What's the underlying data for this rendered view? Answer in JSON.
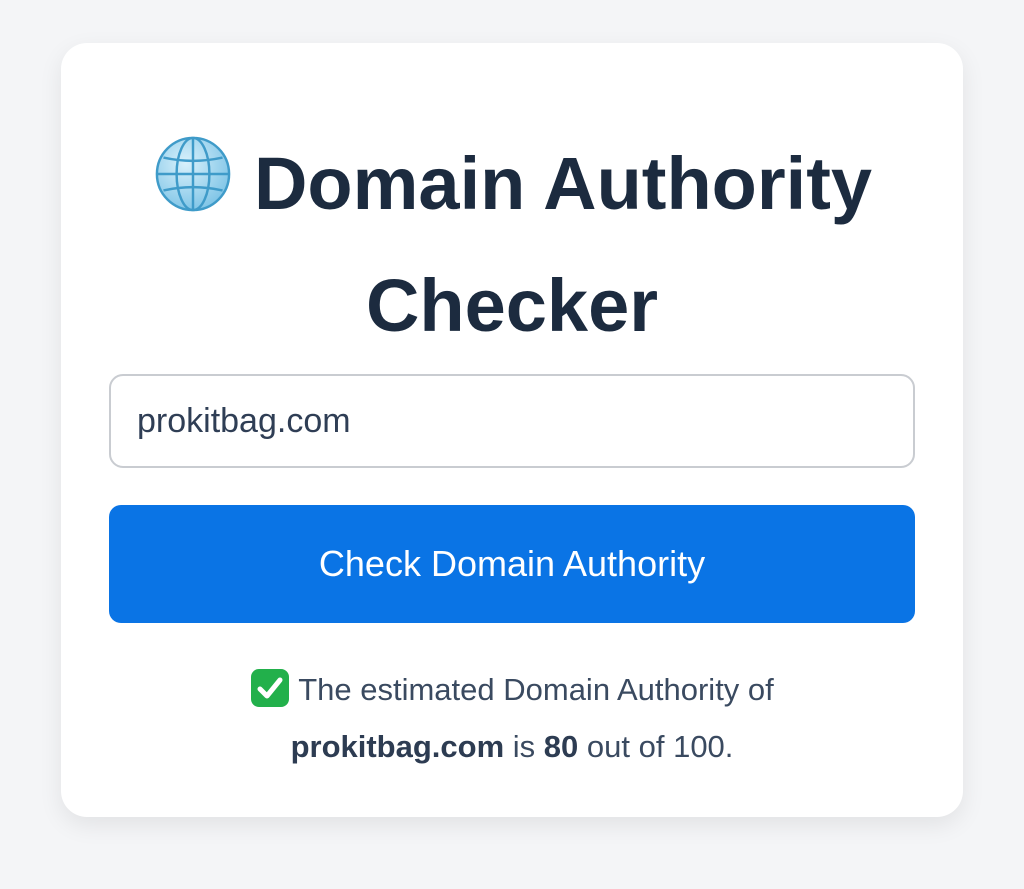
{
  "header": {
    "icon": "globe-icon",
    "title_line1": "Domain Authority",
    "title_line2": "Checker"
  },
  "form": {
    "domain_value": "prokitbag.com",
    "button_label": "Check Domain Authority"
  },
  "result": {
    "icon": "check-mark-icon",
    "prefix": "The estimated Domain Authority of",
    "domain": "prokitbag.com",
    "is_text": "is",
    "score": "80",
    "suffix": "out of 100."
  },
  "colors": {
    "accent": "#0a74e5",
    "title": "#1c2b3f",
    "success": "#22b04b"
  }
}
